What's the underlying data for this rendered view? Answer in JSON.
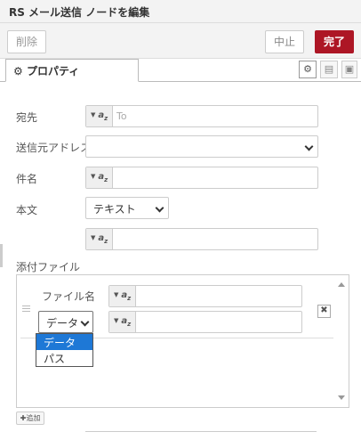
{
  "header": {
    "title": "RS メール送信 ノードを編集"
  },
  "toolbar": {
    "delete_label": "削除",
    "cancel_label": "中止",
    "done_label": "完了"
  },
  "tabs": {
    "properties_label": "プロパティ"
  },
  "form": {
    "to": {
      "label": "宛先",
      "placeholder": "To",
      "type_label": "az"
    },
    "from": {
      "label": "送信元アドレス",
      "value": ""
    },
    "subject": {
      "label": "件名",
      "type_label": "az"
    },
    "body": {
      "label": "本文",
      "format_value": "テキスト",
      "type_label": "az"
    },
    "attachments": {
      "label": "添付ファイル",
      "filename_label": "ファイル名",
      "data_select_value": "データ",
      "dropdown_options": [
        "データ",
        "パス"
      ],
      "selected_option": "データ",
      "add_label": "✚追加"
    }
  },
  "colors": {
    "accent": "#ad1625",
    "selection": "#1e78d6"
  }
}
